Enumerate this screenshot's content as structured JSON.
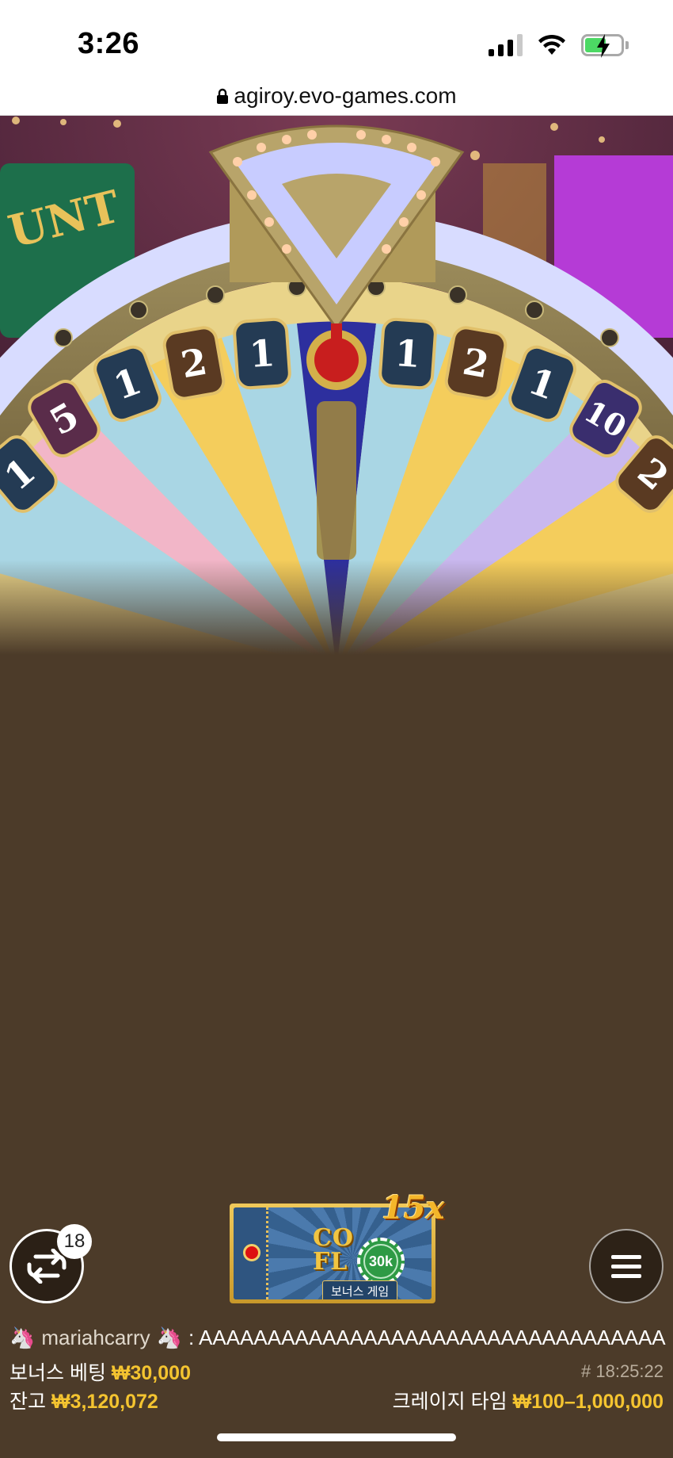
{
  "status_bar": {
    "time": "3:26"
  },
  "browser": {
    "url": "agiroy.evo-games.com"
  },
  "wheel": {
    "segment_labels": [
      "1",
      "5",
      "1",
      "2",
      "1",
      "1",
      "2",
      "1",
      "10",
      "2"
    ],
    "sign_text": "UNT"
  },
  "controls": {
    "replay_count": "18"
  },
  "bonus_ticket": {
    "multiplier": "15x",
    "title_line1": "CO",
    "title_line2": "FL",
    "chip_value": "30k",
    "subtitle": "보너스 게임"
  },
  "chat": {
    "username": "mariahcarry",
    "message": ": AAAAAAAAAAAAAAAAAAAAAAAAAAAAAAAAAA"
  },
  "bonus_bet": {
    "label": "보너스 베팅",
    "amount": "₩30,000",
    "round_id": "# 18:25:22"
  },
  "balance": {
    "label": "잔고",
    "amount": "₩3,120,072",
    "table_name": "크레이지 타임",
    "limits": "₩100–1,000,000"
  },
  "colors": {
    "background": "#4c3b29",
    "accent_gold": "#f4c430"
  }
}
